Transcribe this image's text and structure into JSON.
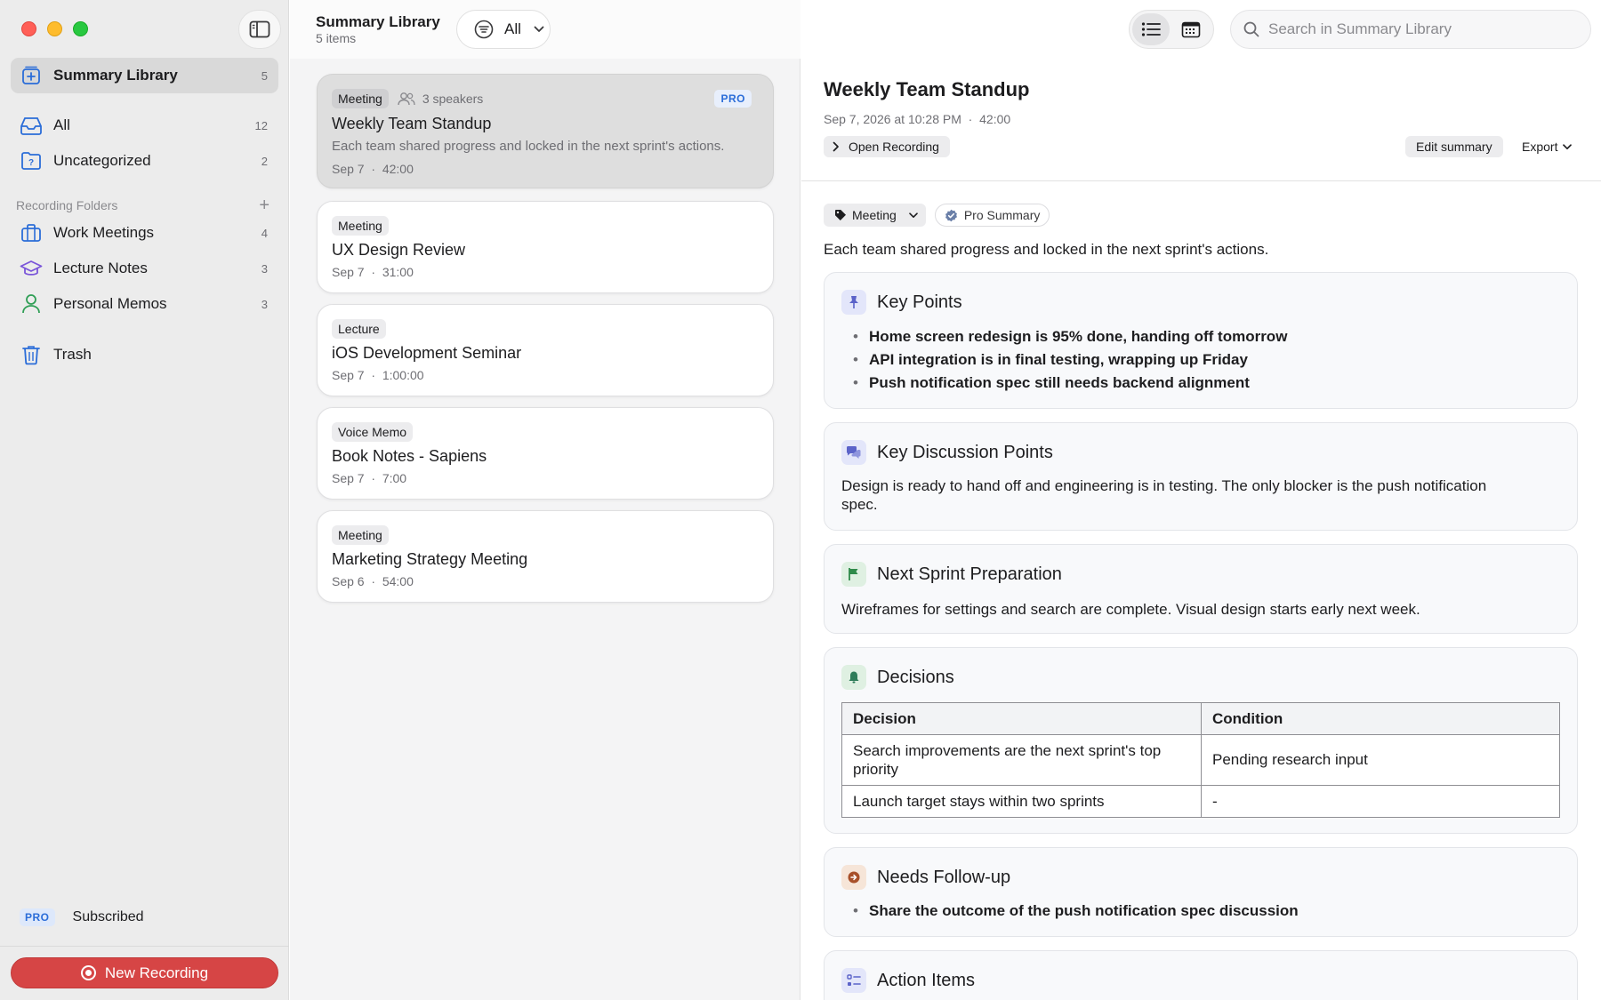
{
  "sidebar": {
    "items": [
      {
        "label": "Summary Library",
        "count": "5"
      },
      {
        "label": "All",
        "count": "12"
      },
      {
        "label": "Uncategorized",
        "count": "2"
      }
    ],
    "section_title": "Recording Folders",
    "folders": [
      {
        "label": "Work Meetings",
        "count": "4"
      },
      {
        "label": "Lecture Notes",
        "count": "3"
      },
      {
        "label": "Personal Memos",
        "count": "3"
      }
    ],
    "trash_label": "Trash",
    "pro_badge": "PRO",
    "subscription_status": "Subscribed",
    "new_recording_label": "New Recording"
  },
  "list": {
    "title": "Summary Library",
    "subtitle": "5 items",
    "filter_label": "All",
    "cards": [
      {
        "tag": "Meeting",
        "speakers": "3 speakers",
        "pro": "PRO",
        "title": "Weekly Team Standup",
        "desc": "Each team shared progress and locked in the next sprint's actions.",
        "date": "Sep 7",
        "duration": "42:00"
      },
      {
        "tag": "Meeting",
        "title": "UX Design Review",
        "date": "Sep 7",
        "duration": "31:00"
      },
      {
        "tag": "Lecture",
        "title": "iOS Development Seminar",
        "date": "Sep 7",
        "duration": "1:00:00"
      },
      {
        "tag": "Voice Memo",
        "title": "Book Notes - Sapiens",
        "date": "Sep 7",
        "duration": "7:00"
      },
      {
        "tag": "Meeting",
        "title": "Marketing Strategy Meeting",
        "date": "Sep 6",
        "duration": "54:00"
      }
    ]
  },
  "detail": {
    "search_placeholder": "Search in Summary Library",
    "title": "Weekly Team Standup",
    "datetime": "Sep 7, 2026 at 10:28 PM",
    "duration": "42:00",
    "open_recording_label": "Open Recording",
    "edit_summary_label": "Edit summary",
    "export_label": "Export",
    "category_label": "Meeting",
    "pro_summary_label": "Pro Summary",
    "summary": "Each team shared progress and locked in the next sprint's actions.",
    "key_points": {
      "title": "Key Points",
      "items": [
        "Home screen redesign is 95% done, handing off tomorrow",
        "API integration is in final testing, wrapping up Friday",
        "Push notification spec still needs backend alignment"
      ]
    },
    "discussion": {
      "title": "Key Discussion Points",
      "text": "Design is ready to hand off and engineering is in testing. The only blocker is the push notification spec."
    },
    "sprint": {
      "title": "Next Sprint Preparation",
      "text": "Wireframes for settings and search are complete. Visual design starts early next week."
    },
    "decisions": {
      "title": "Decisions",
      "headers": [
        "Decision",
        "Condition"
      ],
      "rows": [
        [
          "Search improvements are the next sprint's top priority",
          "Pending research input"
        ],
        [
          "Launch target stays within two sprints",
          "-"
        ]
      ]
    },
    "followup": {
      "title": "Needs Follow-up",
      "items": [
        "Share the outcome of the push notification spec discussion"
      ]
    },
    "action_items": {
      "title": "Action Items"
    }
  },
  "colors": {
    "accent_blue": "#2b6dd8",
    "record_red": "#d64545",
    "sidebar_bg": "#ececec"
  },
  "icons": [
    "sidebar-toggle-icon",
    "library-icon",
    "tray-icon",
    "question-folder-icon",
    "plus-icon",
    "briefcase-icon",
    "graduation-cap-icon",
    "person-icon",
    "trash-icon",
    "record-icon",
    "filter-icon",
    "chevron-down-icon",
    "people-icon",
    "list-view-icon",
    "calendar-view-icon",
    "search-icon",
    "chevron-right-icon",
    "tag-icon",
    "verified-badge-icon",
    "pin-icon",
    "chat-bubbles-icon",
    "flag-icon",
    "bell-icon",
    "arrow-circle-icon",
    "checklist-icon"
  ]
}
